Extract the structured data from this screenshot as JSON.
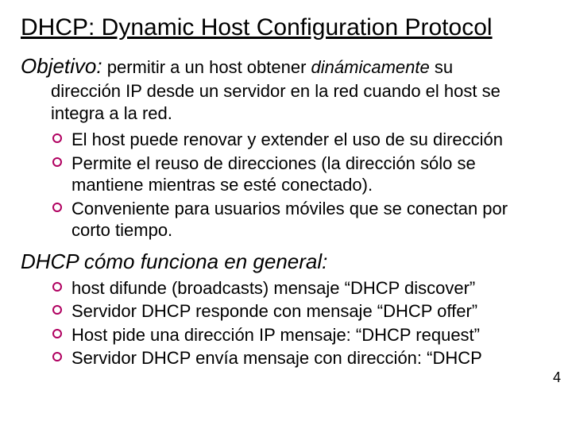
{
  "title": "DHCP: Dynamic Host Configuration Protocol",
  "objective": {
    "label": "Objetivo:",
    "lead_before": " permitir a un host obtener ",
    "lead_em": "dinámicamente",
    "lead_after": " su",
    "body": "dirección IP desde un servidor en la red cuando el host se integra a la red.",
    "bullets": [
      "El host puede renovar y extender el uso de su dirección",
      "Permite el reuso de direcciones (la dirección sólo se mantiene mientras se esté conectado).",
      "Conveniente para usuarios móviles que se conectan por corto tiempo."
    ]
  },
  "how": {
    "heading": "DHCP cómo funciona en general:",
    "bullets": [
      "host difunde (broadcasts) mensaje “DHCP discover”",
      "Servidor DHCP responde con mensaje “DHCP offer”",
      "Host pide una dirección IP mensaje:  “DHCP request”",
      "Servidor DHCP envía mensaje con dirección: “DHCP"
    ]
  },
  "page_number": "4"
}
